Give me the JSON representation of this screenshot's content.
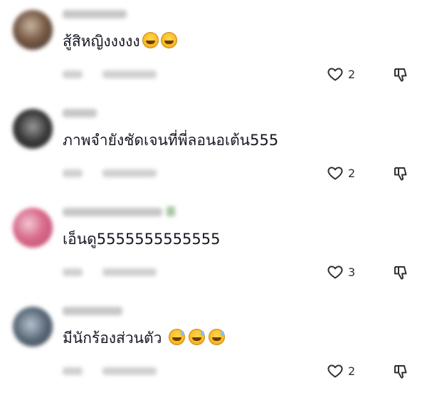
{
  "comments": [
    {
      "text": "สู้สิหญิงงงงง",
      "emoji": [
        "face-with-tears-of-joy",
        "face-with-tears-of-joy"
      ],
      "likes": "2",
      "avatar_color": "#6d5a4a"
    },
    {
      "text": "ภาพจำยังชัดเจนที่พี่ลอนอเต้น555",
      "emoji": [],
      "likes": "2",
      "avatar_color": "#3a3a3a"
    },
    {
      "text": "เอ็นดู5555555555555",
      "emoji": [],
      "likes": "3",
      "avatar_color": "#d86a8a"
    },
    {
      "text": "มีนักร้องส่วนตัว",
      "emoji": [
        "grinning-face-with-sweat",
        "grinning-face-with-sweat",
        "grinning-face-with-sweat"
      ],
      "likes": "2",
      "avatar_color": "#5a6a7a"
    }
  ],
  "icons": {
    "like": "heart-outline-icon",
    "dislike": "thumbs-down-outline-icon"
  },
  "colors": {
    "text": "#161823",
    "icon": "#2f2f33"
  }
}
